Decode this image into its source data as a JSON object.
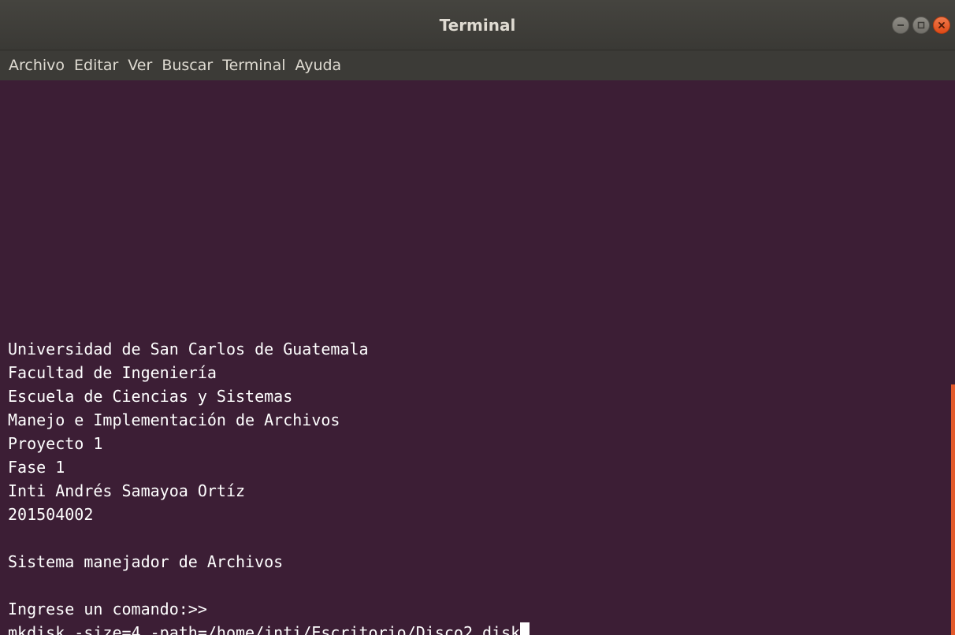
{
  "window": {
    "title": "Terminal"
  },
  "controls": {
    "minimize": "minimize-icon",
    "maximize": "maximize-icon",
    "close": "close-icon"
  },
  "menubar": {
    "items": [
      "Archivo",
      "Editar",
      "Ver",
      "Buscar",
      "Terminal",
      "Ayuda"
    ]
  },
  "terminal": {
    "lines": [
      "Universidad de San Carlos de Guatemala",
      "Facultad de Ingeniería",
      "Escuela de Ciencias y Sistemas",
      "Manejo e Implementación de Archivos",
      "Proyecto 1",
      "Fase 1",
      "Inti Andrés Samayoa Ortíz",
      "201504002",
      "",
      "Sistema manejador de Archivos",
      "",
      "Ingrese un comando:>>"
    ],
    "input_line": "mkdisk -size=4 -path=/home/inti/Escritorio/Disco2.disk"
  },
  "colors": {
    "background": "#3c1e35",
    "text": "#ffffff",
    "titlebar": "#3c3b37",
    "accent": "#e35a2b"
  }
}
